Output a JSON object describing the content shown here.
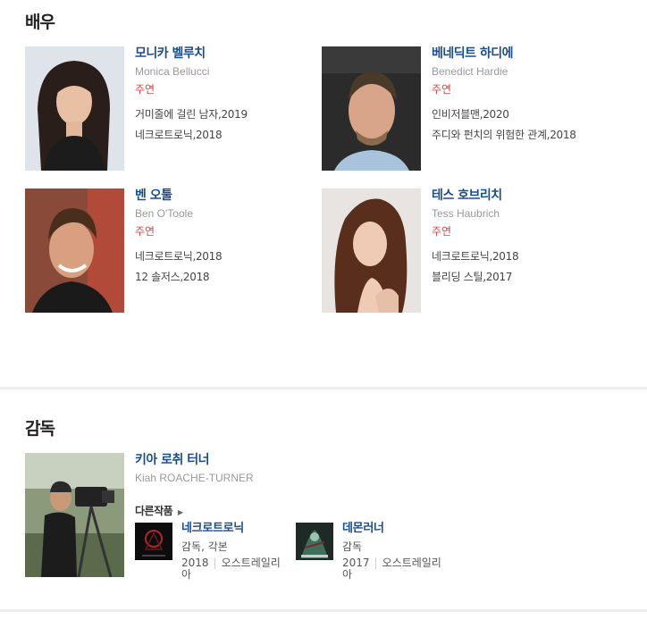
{
  "actors_section": {
    "title": "배우",
    "actors": [
      {
        "name_ko": "모니카 벨루치",
        "name_en": "Monica Bellucci",
        "role": "주연",
        "works": [
          "거미줄에 걸린 남자,2019",
          "네크로트로닉,2018"
        ]
      },
      {
        "name_ko": "베네딕트 하디에",
        "name_en": "Benedict Hardie",
        "role": "주연",
        "works": [
          "인비저블맨,2020",
          "주디와 펀치의 위험한 관계,2018"
        ]
      },
      {
        "name_ko": "벤 오툴",
        "name_en": "Ben O'Toole",
        "role": "주연",
        "works": [
          "네크로트로닉,2018",
          "12 솔저스,2018"
        ]
      },
      {
        "name_ko": "테스 호브리치",
        "name_en": "Tess Haubrich",
        "role": "주연",
        "works": [
          "네크로트로닉,2018",
          "블리딩 스틸,2017"
        ]
      }
    ]
  },
  "director_section": {
    "title": "감독",
    "director": {
      "name_ko": "키아 로취 터너",
      "name_en": "Kiah ROACHE-TURNER",
      "other_works_label": "다른작품",
      "films": [
        {
          "title": "네크로트로닉",
          "role": "감독, 각본",
          "year": "2018",
          "country": "오스트레일리아"
        },
        {
          "title": "데몬러너",
          "role": "감독",
          "year": "2017",
          "country": "오스트레일리아"
        }
      ]
    }
  },
  "colors": {
    "name_link": "#1a4d8f",
    "role": "#dd4444",
    "divider": "#eeeeee"
  }
}
